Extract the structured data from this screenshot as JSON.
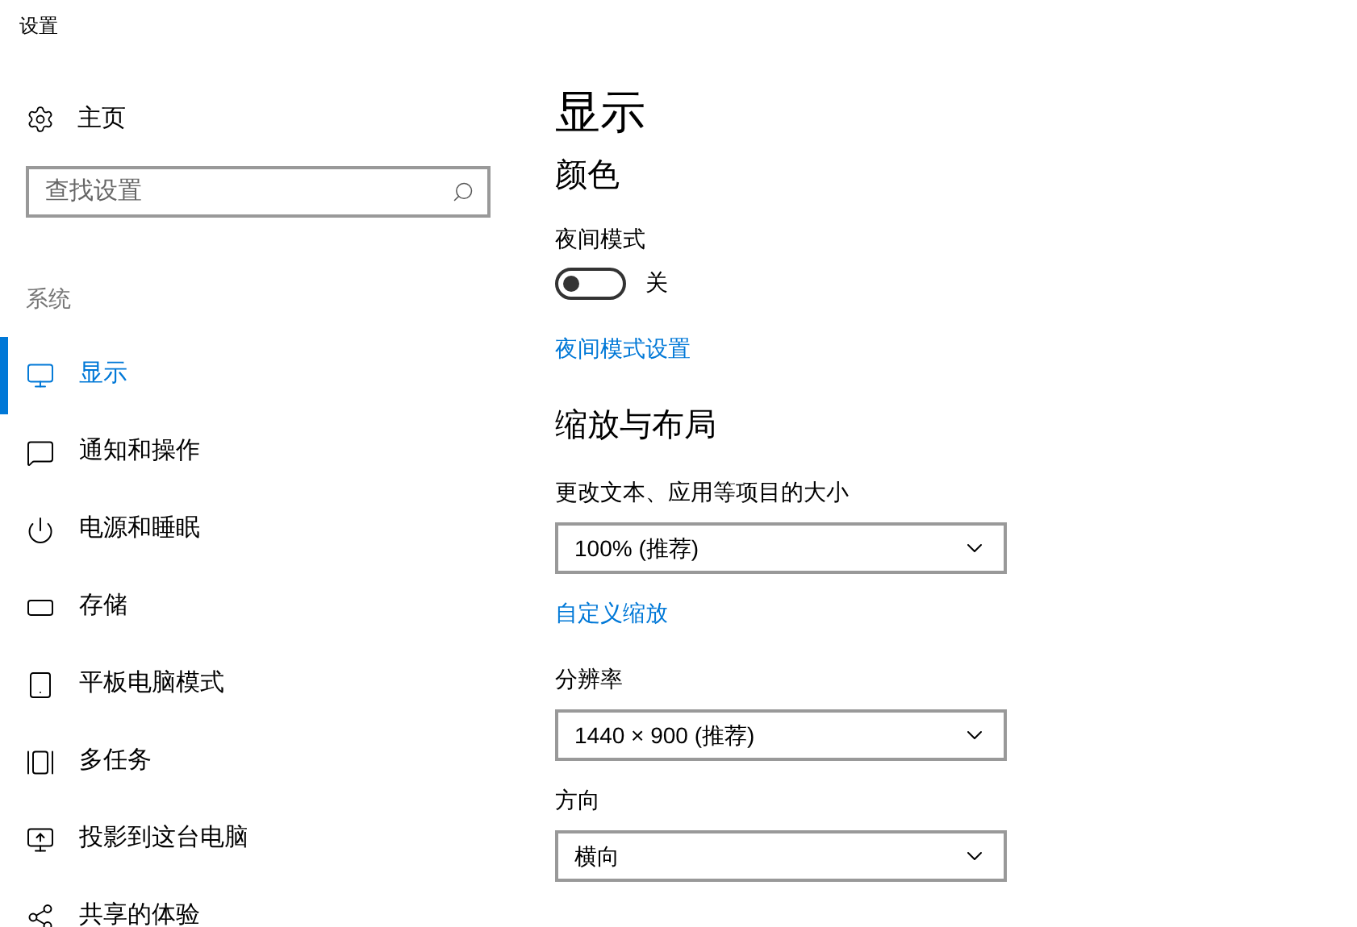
{
  "window": {
    "title": "设置"
  },
  "sidebar": {
    "home": "主页",
    "search": {
      "placeholder": "查找设置"
    },
    "section": "系统",
    "items": [
      {
        "label": "显示",
        "kind": "display",
        "selected": true
      },
      {
        "label": "通知和操作",
        "kind": "notifications",
        "selected": false
      },
      {
        "label": "电源和睡眠",
        "kind": "power",
        "selected": false
      },
      {
        "label": "存储",
        "kind": "storage",
        "selected": false
      },
      {
        "label": "平板电脑模式",
        "kind": "tablet",
        "selected": false
      },
      {
        "label": "多任务",
        "kind": "multitask",
        "selected": false
      },
      {
        "label": "投影到这台电脑",
        "kind": "project",
        "selected": false
      },
      {
        "label": "共享的体验",
        "kind": "shared",
        "selected": false
      }
    ]
  },
  "content": {
    "title": "显示",
    "color_heading": "颜色",
    "night_mode": {
      "label": "夜间模式",
      "on": false,
      "state_text": "关"
    },
    "night_mode_link": "夜间模式设置",
    "scale_heading": "缩放与布局",
    "scale_label": "更改文本、应用等项目的大小",
    "scale_value": "100% (推荐)",
    "custom_scale_link": "自定义缩放",
    "resolution_label": "分辨率",
    "resolution_value": "1440 × 900 (推荐)",
    "orientation_label": "方向",
    "orientation_value": "横向"
  }
}
